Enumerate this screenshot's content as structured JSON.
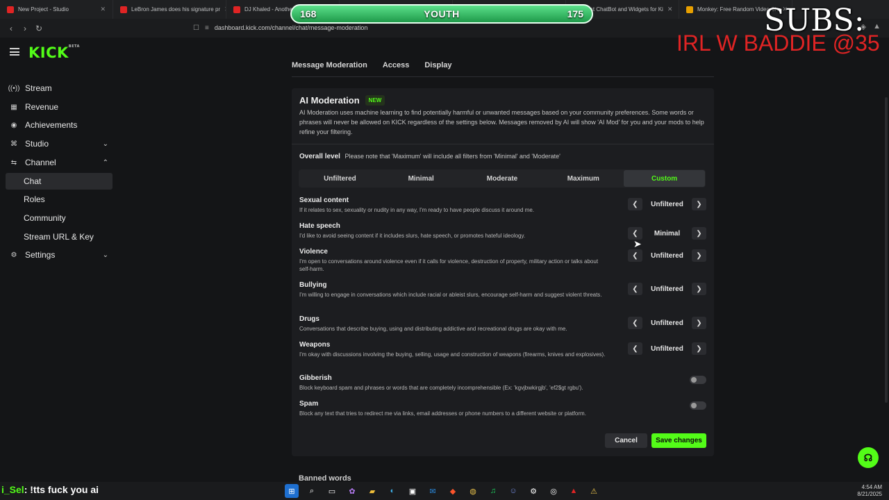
{
  "browser": {
    "tabs": [
      {
        "title": "New Project - Studio",
        "color": "#e02424"
      },
      {
        "title": "LeBron James does his signature pr",
        "color": "#e02424"
      },
      {
        "title": "DJ Khaled - Anothe",
        "color": "#e02424"
      },
      {
        "title": "",
        "color": "#3a3b3f"
      },
      {
        "title": "",
        "color": "#3a3b3f"
      },
      {
        "title": "best ChatBot and Widgets for Ki",
        "color": "#53fc18"
      },
      {
        "title": "Monkey: Free Random Video Ch",
        "color": "#e8a000"
      }
    ],
    "url": "dashboard.kick.com/channel/chat/message-moderation"
  },
  "overlay": {
    "left_count": "168",
    "label": "YOUTH",
    "right_count": "175",
    "subs_text": "SUBS:",
    "ticker_text": "IRL W BADDIE @35"
  },
  "sidebar": {
    "logo": "KICK",
    "logo_sup": "BETA",
    "items": [
      {
        "label": "Stream",
        "icon": "broadcast-icon",
        "glyph": "((•))"
      },
      {
        "label": "Revenue",
        "icon": "revenue-icon",
        "glyph": "▦"
      },
      {
        "label": "Achievements",
        "icon": "achievements-icon",
        "glyph": "◉"
      },
      {
        "label": "Studio",
        "icon": "studio-icon",
        "glyph": "⌘",
        "chevron": "⌄"
      },
      {
        "label": "Channel",
        "icon": "channel-icon",
        "glyph": "⇆",
        "chevron": "⌃"
      },
      {
        "label": "Chat"
      },
      {
        "label": "Roles"
      },
      {
        "label": "Community"
      },
      {
        "label": "Stream URL & Key"
      },
      {
        "label": "Settings",
        "icon": "gear-icon",
        "glyph": "⚙",
        "chevron": "⌄"
      }
    ]
  },
  "main": {
    "tabs": [
      "Message Moderation",
      "Access",
      "Display"
    ],
    "ai": {
      "title": "AI Moderation",
      "badge": "NEW",
      "description": "AI Moderation uses machine learning to find potentially harmful or unwanted messages based on your community preferences. Some words or phrases will never be allowed on KICK regardless of the settings below. Messages removed by AI will show 'AI Mod' for you and your mods to help refine your filtering.",
      "overall_label": "Overall level",
      "overall_note": "Please note that 'Maximum' will include all filters from 'Minimal' and 'Moderate'",
      "levels": [
        "Unfiltered",
        "Minimal",
        "Moderate",
        "Maximum",
        "Custom"
      ],
      "selected_level": "Custom"
    },
    "filters": [
      {
        "title": "Sexual content",
        "desc": "If it relates to sex, sexuality or nudity in any way, I'm ready to have people discuss it around me.",
        "value": "Unfiltered"
      },
      {
        "title": "Hate speech",
        "desc": "I'd like to avoid seeing content if it includes slurs, hate speech, or promotes hateful ideology.",
        "value": "Minimal"
      },
      {
        "title": "Violence",
        "desc": "I'm open to conversations around violence even if it calls for violence, destruction of property, military action or talks about self-harm.",
        "value": "Unfiltered"
      },
      {
        "title": "Bullying",
        "desc": "I'm willing to engage in conversations which include racial or ableist slurs, encourage self-harm and suggest violent threats.",
        "value": "Unfiltered"
      },
      {
        "title": "Drugs",
        "desc": "Conversations that describe buying, using and distributing addictive and recreational drugs are okay with me.",
        "value": "Unfiltered"
      },
      {
        "title": "Weapons",
        "desc": "I'm okay with discussions involving the buying, selling, usage and construction of weapons (firearms, knives and explosives).",
        "value": "Unfiltered"
      }
    ],
    "toggles": [
      {
        "title": "Gibberish",
        "desc": "Block keyboard spam and phrases or words that are completely incomprehensible (Ex: 'kgvjbwkirgjb', 'ef2$gt rgbu').",
        "on": false
      },
      {
        "title": "Spam",
        "desc": "Block any text that tries to redirect me via links, email addresses or phone numbers to a different website or platform.",
        "on": false
      }
    ],
    "cancel_label": "Cancel",
    "save_label": "Save changes",
    "next_section": "Banned words"
  },
  "taskbar": {
    "chat_user": "i_Sel",
    "chat_message": ": !tts fuck you ai",
    "time": "4:54 AM",
    "date": "8/21/2025"
  },
  "colors": {
    "accent": "#53fc18",
    "background": "#141517",
    "card": "#1c1d20"
  }
}
